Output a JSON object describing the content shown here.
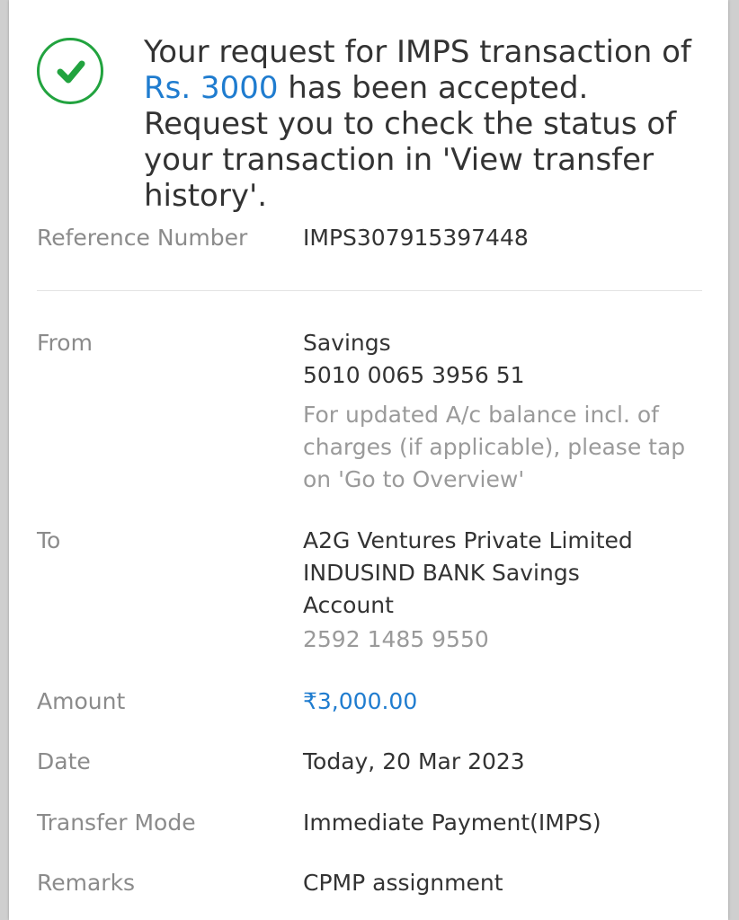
{
  "confirmation": {
    "message_prefix": "Your request for IMPS transaction of ",
    "amount": "Rs. 3000",
    "message_suffix": " has been accepted. Request you to check the status of your transaction in 'View transfer history'.",
    "icon": "check-circle-icon",
    "icon_color": "#22a33f",
    "accent_color": "#1f7ccf"
  },
  "details": {
    "reference": {
      "label": "Reference Number",
      "value": "IMPS307915397448"
    },
    "from": {
      "label": "From",
      "account_type": "Savings",
      "account_number": "5010 0065 3956 51",
      "note": "For updated A/c balance incl. of charges (if applicable), please tap on 'Go to Overview'"
    },
    "to": {
      "label": "To",
      "payee_name": "A2G Ventures Private Limited",
      "bank_line1": "INDUSIND BANK Savings",
      "bank_line2": "Account",
      "account_number": "2592 1485 9550"
    },
    "amount": {
      "label": "Amount",
      "value": "₹3,000.00"
    },
    "date": {
      "label": "Date",
      "value": "Today, 20 Mar 2023"
    },
    "transfer_mode": {
      "label": "Transfer Mode",
      "value": "Immediate Payment(IMPS)"
    },
    "remarks": {
      "label": "Remarks",
      "value": "CPMP assignment"
    }
  }
}
